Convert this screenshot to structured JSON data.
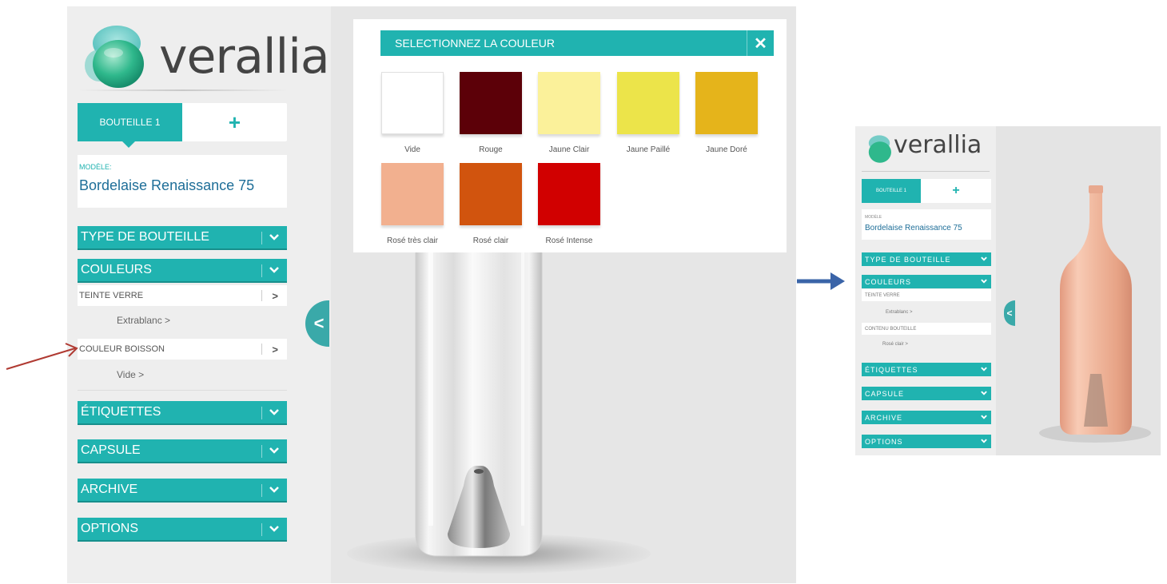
{
  "brand": {
    "name": "verallia",
    "accent": "#20b3b0",
    "title_color": "#1e6e98"
  },
  "tabs": {
    "active": "BOUTEILLE 1",
    "add": "+"
  },
  "model": {
    "label": "MODÈLE:",
    "name": "Bordelaise Renaissance 75"
  },
  "sections": {
    "type": "TYPE DE BOUTEILLE",
    "couleurs": "COULEURS",
    "teinte_verre": "TEINTE VERRE",
    "teinte_value": "Extrablanc  >",
    "couleur_boisson": "COULEUR BOISSON",
    "boisson_value": "Vide  >",
    "etiquettes": "ÉTIQUETTES",
    "capsule": "CAPSULE",
    "archive": "ARCHIVE",
    "options": "OPTIONS"
  },
  "collapse_glyph": "<",
  "modal": {
    "title": "SELECTIONNEZ LA COULEUR",
    "close": "✕",
    "colors": [
      {
        "label": "Vide",
        "color": "#ffffff"
      },
      {
        "label": "Rouge",
        "color": "#5c0008"
      },
      {
        "label": "Jaune Clair",
        "color": "#fbf19a"
      },
      {
        "label": "Jaune Paillé",
        "color": "#ece44a"
      },
      {
        "label": "Jaune Doré",
        "color": "#e5b41b"
      },
      {
        "label": "Rosé très clair",
        "color": "#f2b08f"
      },
      {
        "label": "Rosé clair",
        "color": "#d1540e"
      },
      {
        "label": "Rosé Intense",
        "color": "#d10000"
      }
    ]
  },
  "thumbnail": {
    "logo": "verallia",
    "tab_active": "BOUTEILLE 1",
    "tab_add": "+",
    "model_label": "MODÈLE",
    "model_name": "Bordelaise Renaissance 75",
    "type": "TYPE DE BOUTEILLE",
    "couleurs": "COULEURS",
    "teinte_verre": "TEINTE VERRE",
    "teinte_value": "Extrablanc  >",
    "contenu": "CONTENU BOUTEILLE",
    "contenu_value": "Rosé clair  >",
    "etiquettes": "ÉTIQUETTES",
    "capsule": "CAPSULE",
    "archive": "ARCHIVE",
    "options": "OPTIONS",
    "bottle_color": "#f0b89e"
  },
  "annotations": {
    "red_arrow_color": "#b03a32",
    "blue_arrow_color": "#3a64a8"
  }
}
